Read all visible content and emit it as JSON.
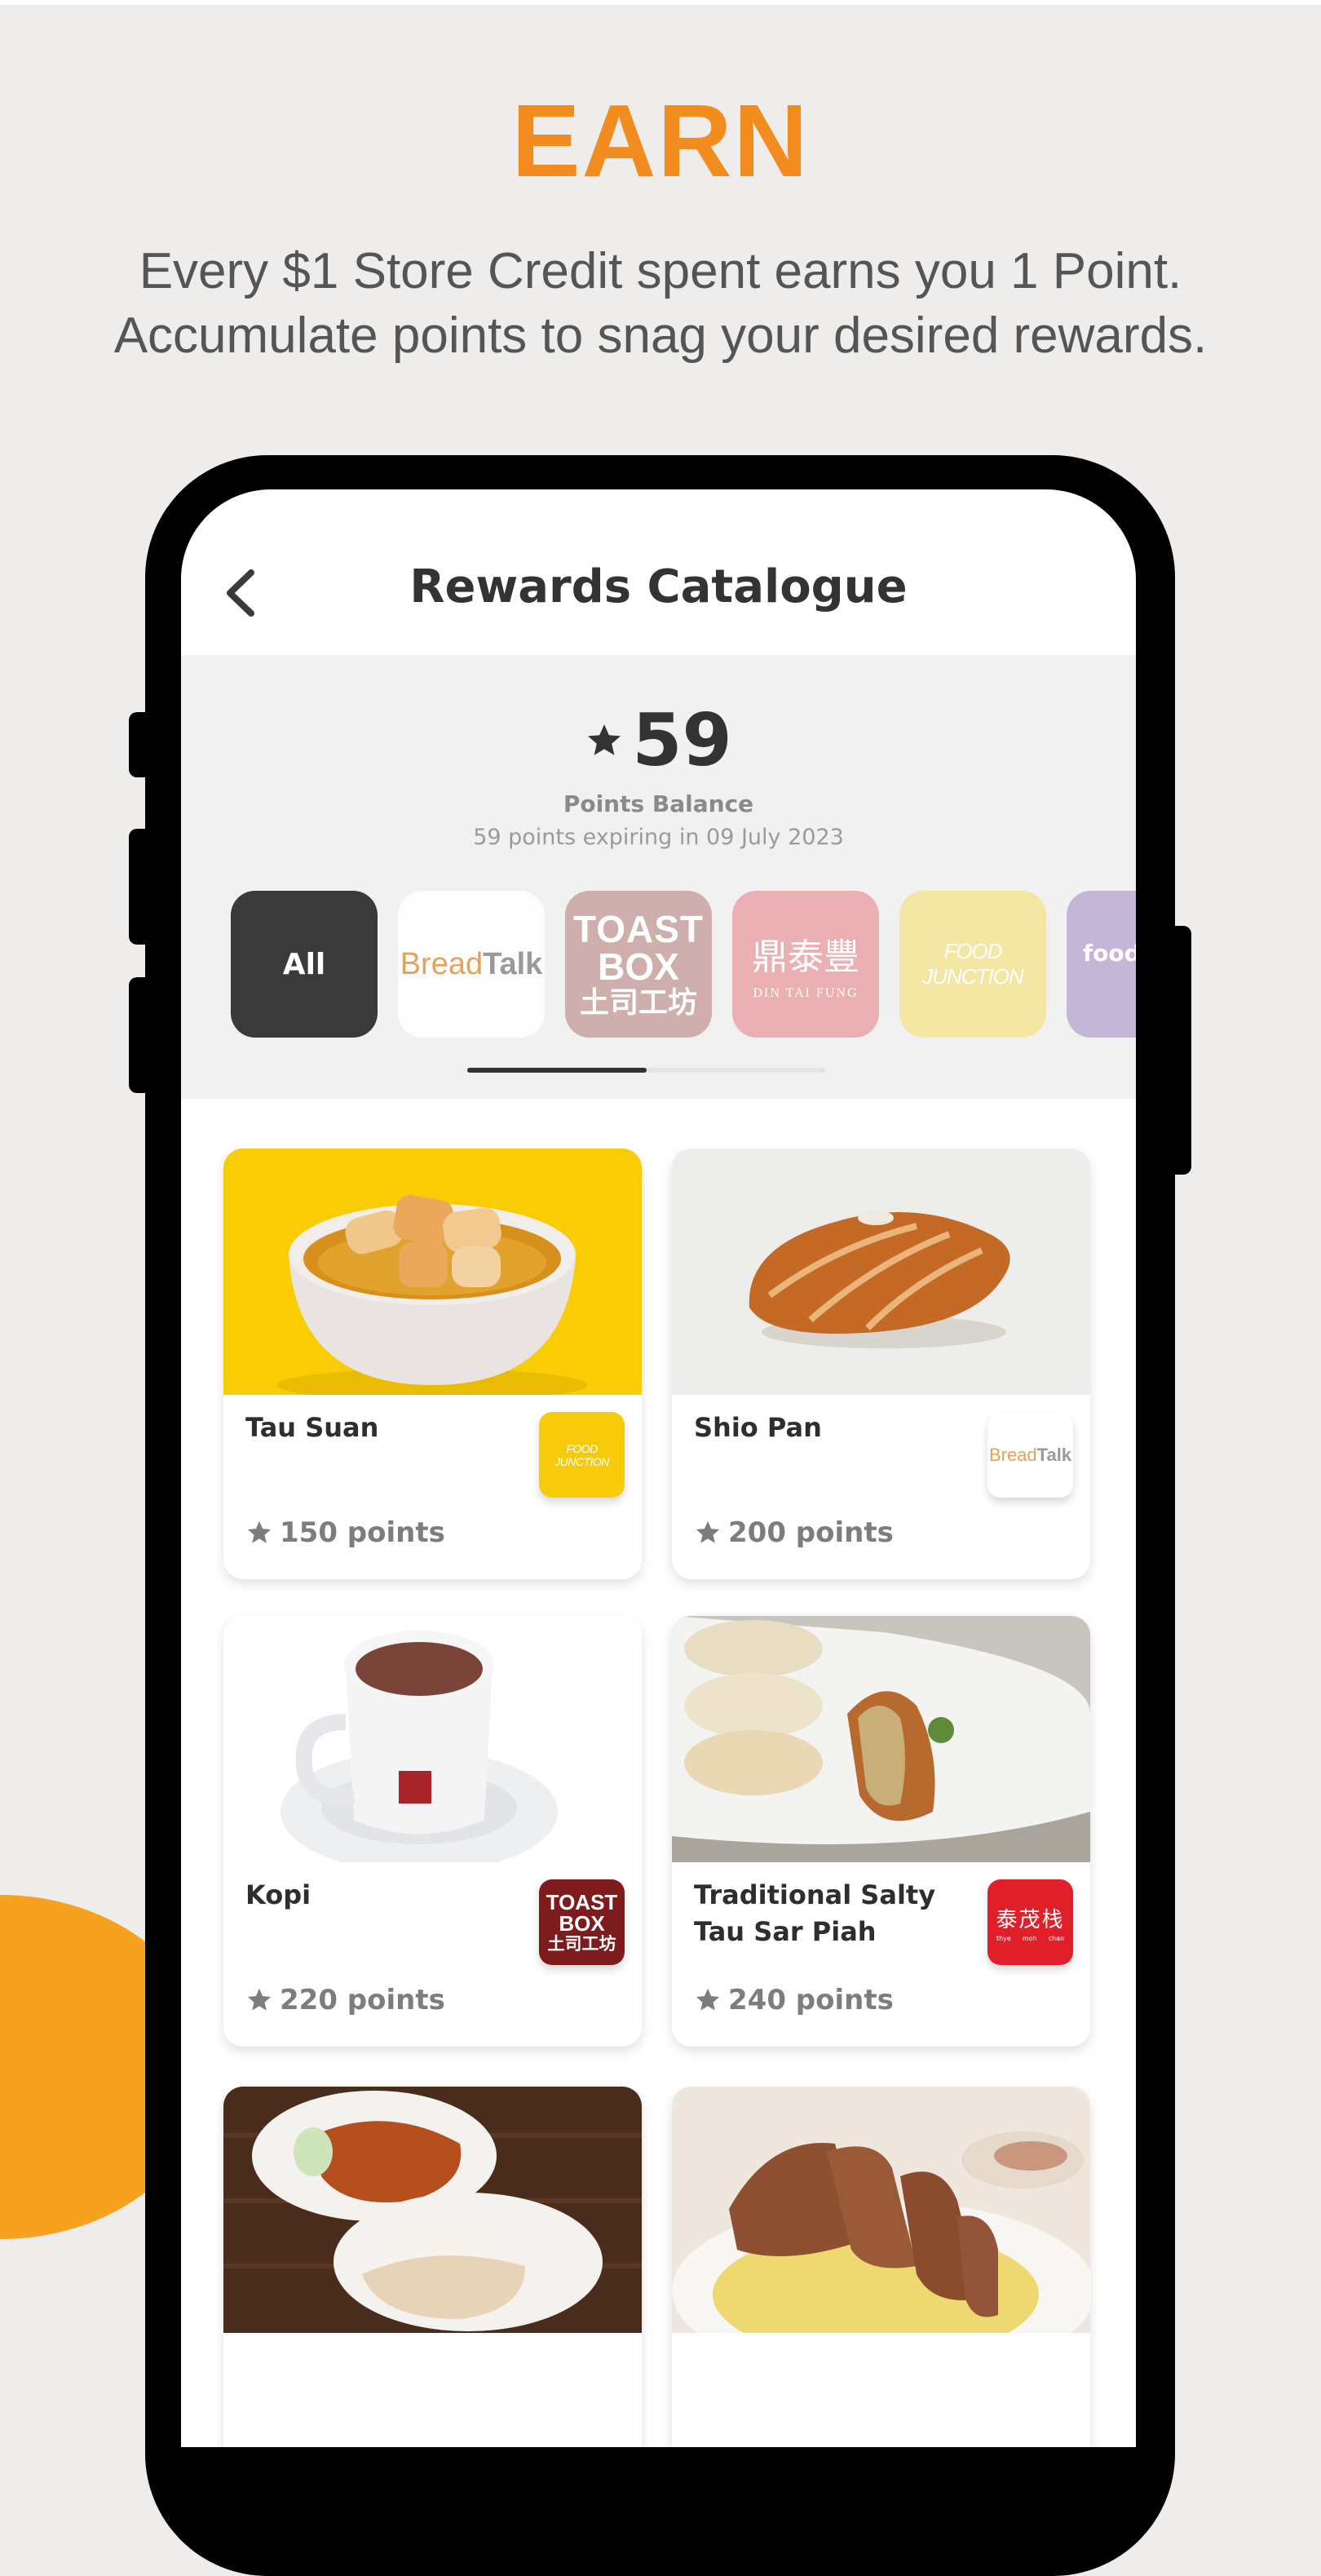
{
  "promo": {
    "headline": "EARN",
    "subtitle_line1": "Every $1 Store Credit spent earns you 1 Point.",
    "subtitle_line2": "Accumulate points to snag your desired rewards.",
    "accent_color": "#F28C1F",
    "decor_color": "#F7A21E"
  },
  "app": {
    "header": {
      "back_icon": "chevron-left-icon",
      "title": "Rewards Catalogue"
    },
    "balance": {
      "icon": "star-icon",
      "points": "59",
      "label": "Points Balance",
      "expiry": "59 points expiring in 09 July 2023"
    },
    "brand_filters": [
      {
        "id": "all",
        "label": "All",
        "selected": true
      },
      {
        "id": "breadtalk",
        "label": "BreadTalk",
        "logo_text_a": "Bread",
        "logo_text_b": "Talk"
      },
      {
        "id": "toastbox",
        "label": "Toast Box",
        "logo_line1": "TOAST",
        "logo_line2": "BOX",
        "logo_line3": "土司工坊"
      },
      {
        "id": "dintaifung",
        "label": "Din Tai Fung",
        "logo_cn": "鼎泰豐",
        "logo_en": "DIN TAI FUNG"
      },
      {
        "id": "foodjunction",
        "label": "Food Junction",
        "logo_text": "FOOD JUNCTION"
      },
      {
        "id": "foodrepublic",
        "label": "Food Republic",
        "logo_text": "foodr"
      }
    ],
    "filter_scroll": {
      "visible_fraction": 0.5,
      "offset_fraction": 0
    },
    "rewards": [
      {
        "name": "Tau Suan",
        "points": "150 points",
        "brand": "Food Junction",
        "brand_logo_text": "FOOD JUNCTION",
        "image": "tau-suan-bowl"
      },
      {
        "name": "Shio Pan",
        "points": "200 points",
        "brand": "BreadTalk",
        "brand_logo_text_a": "Bread",
        "brand_logo_text_b": "Talk",
        "image": "shio-pan-bread"
      },
      {
        "name": "Kopi",
        "points": "220 points",
        "brand": "Toast Box",
        "brand_logo_line1": "TOAST",
        "brand_logo_line2": "BOX",
        "brand_logo_line3": "土司工坊",
        "image": "kopi-cup"
      },
      {
        "name": "Traditional Salty Tau Sar Piah",
        "points": "240 points",
        "brand": "Thye Moh Chan",
        "brand_logo_cn": "泰茂栈",
        "brand_logo_en": [
          "thye",
          "moh",
          "chan"
        ],
        "image": "tau-sar-piah-pastry"
      },
      {
        "name": "",
        "points": "",
        "brand": "",
        "image": "chicken-rice"
      },
      {
        "name": "",
        "points": "",
        "brand": "",
        "image": "pork-chop-fried-rice"
      }
    ]
  }
}
